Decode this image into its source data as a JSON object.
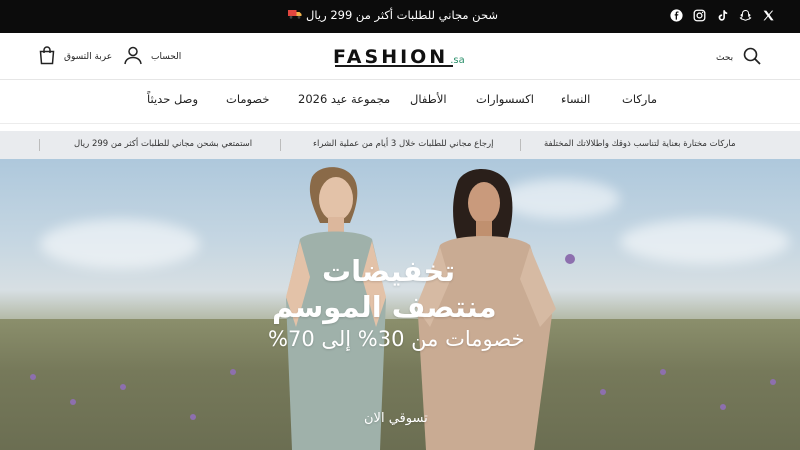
{
  "announcement": {
    "text": "شحن مجاني للطلبات أكثر من 299 ريال",
    "truck_icon": "delivery-truck-icon",
    "social_icons": [
      "facebook-icon",
      "instagram-icon",
      "tiktok-icon",
      "snapchat-icon",
      "x-icon"
    ]
  },
  "header": {
    "logo_text": "FASHION",
    "logo_suffix": ".sa",
    "search_label": "بحث",
    "account_label": "الحساب",
    "cart_label": "عربة التسوق"
  },
  "nav": {
    "items": [
      "ماركات",
      "النساء",
      "اكسسوارات",
      "الأطفال",
      "مجموعة عيد 2026",
      "خصومات",
      "وصل حديثاً"
    ]
  },
  "benefits": [
    "ماركات مختارة بعناية لتناسب ذوقك واطلالاتك المختلفة",
    "إرجاع مجاني للطلبات خلال 3 أيام من عملية الشراء",
    "استمتعي بشحن مجاني للطلبات أكثر من 299 ريال"
  ],
  "hero": {
    "title_line1": "تخفيضات",
    "title_line2": "منتصف الموسم",
    "subtitle": "خصومات من 30% إلى 70%",
    "cta": "تسوقي الان"
  },
  "colors": {
    "topbar_bg": "#0c0c0c",
    "logo_accent": "#2a8f6a",
    "benefits_bg": "#e9ebee"
  }
}
